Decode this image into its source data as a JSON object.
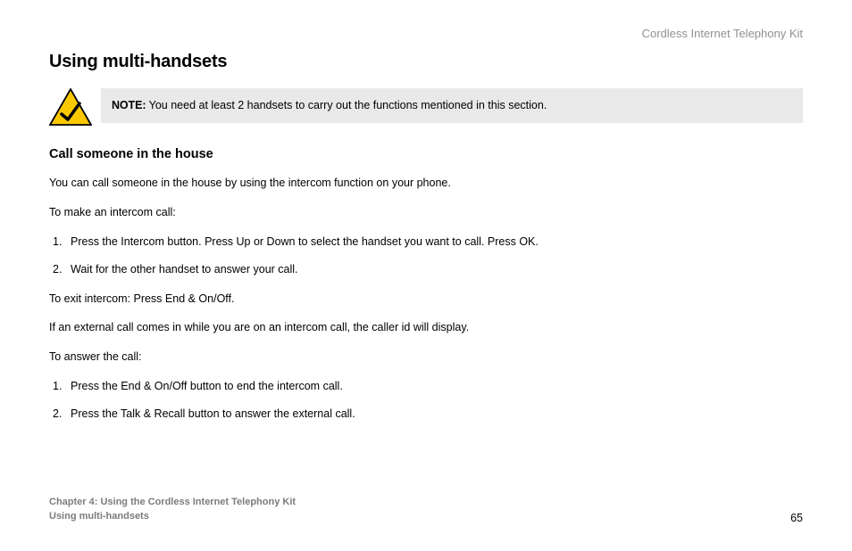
{
  "header": {
    "product_label": "Cordless Internet Telephony Kit"
  },
  "title": "Using multi-handsets",
  "note": {
    "prefix": "NOTE:",
    "text": "You need at least 2 handsets to carry out the functions mentioned in this section."
  },
  "section": {
    "heading": "Call someone in the house",
    "intro": "You can call someone in the house by using the intercom function on your phone.",
    "intercom_lead": "To make an intercom call:",
    "intercom_steps": [
      "Press the Intercom button. Press Up or Down to select the handset you want to call. Press OK.",
      "Wait for the other handset to answer your call."
    ],
    "exit_line": "To exit intercom: Press End & On/Off.",
    "external_line": "If an external call comes in while you are on an intercom call, the caller id will display.",
    "answer_lead": "To answer the call:",
    "answer_steps": [
      "Press the End & On/Off button to end the intercom call.",
      "Press the Talk & Recall button to answer the external call."
    ]
  },
  "footer": {
    "chapter_line": "Chapter 4: Using the Cordless Internet Telephony Kit",
    "section_line": "Using multi-handsets",
    "page_number": "65"
  },
  "icons": {
    "note_icon": "alert-check-triangle"
  }
}
